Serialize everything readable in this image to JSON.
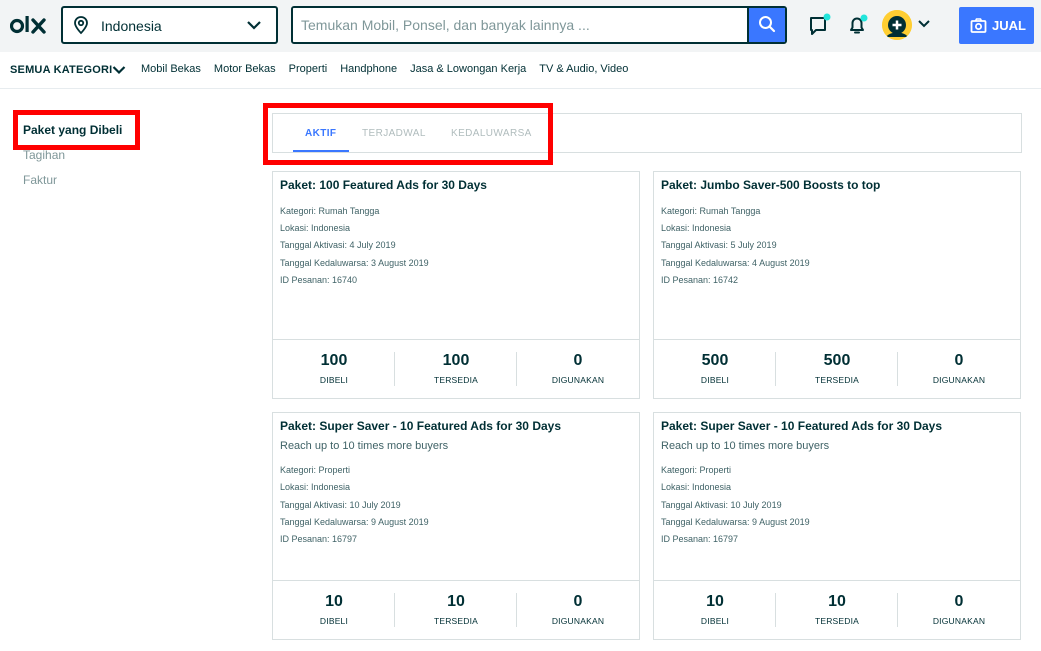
{
  "header": {
    "logo_text": "olx",
    "location": "Indonesia",
    "search_placeholder": "Temukan Mobil, Ponsel, dan banyak lainnya ...",
    "sell_label": "JUAL",
    "colors": {
      "accent": "#3a77ff",
      "dark": "#002f34",
      "avatar": "#ffce32",
      "notification_dot": "#23e5db"
    }
  },
  "categories": {
    "all_label": "SEMUA KATEGORI",
    "links": [
      "Mobil Bekas",
      "Motor Bekas",
      "Properti",
      "Handphone",
      "Jasa & Lowongan Kerja",
      "TV & Audio, Video"
    ]
  },
  "sidebar": {
    "items": [
      {
        "label": "Paket yang Dibeli",
        "active": true
      },
      {
        "label": "Tagihan",
        "active": false
      },
      {
        "label": "Faktur",
        "active": false
      }
    ]
  },
  "tabs": [
    {
      "label": "AKTIF",
      "active": true
    },
    {
      "label": "TERJADWAL",
      "active": false
    },
    {
      "label": "KEDALUWARSA",
      "active": false
    }
  ],
  "cards": [
    {
      "title": "Paket: 100 Featured Ads for 30 Days",
      "subtitle": "",
      "meta": [
        "Kategori: Rumah Tangga",
        "Lokasi: Indonesia",
        "Tanggal Aktivasi: 4 July 2019",
        "Tanggal Kedaluwarsa: 3 August 2019",
        "ID Pesanan: 16740"
      ],
      "stats": [
        {
          "value": "100",
          "label": "DIBELI"
        },
        {
          "value": "100",
          "label": "TERSEDIA"
        },
        {
          "value": "0",
          "label": "DIGUNAKAN"
        }
      ]
    },
    {
      "title": "Paket: Jumbo Saver-500 Boosts to top",
      "subtitle": "",
      "meta": [
        "Kategori: Rumah Tangga",
        "Lokasi: Indonesia",
        "Tanggal Aktivasi: 5 July 2019",
        "Tanggal Kedaluwarsa: 4 August 2019",
        "ID Pesanan: 16742"
      ],
      "stats": [
        {
          "value": "500",
          "label": "DIBELI"
        },
        {
          "value": "500",
          "label": "TERSEDIA"
        },
        {
          "value": "0",
          "label": "DIGUNAKAN"
        }
      ]
    },
    {
      "title": "Paket: Super Saver - 10 Featured Ads for 30 Days",
      "subtitle": "Reach up to 10 times more buyers",
      "meta": [
        "Kategori: Properti",
        "Lokasi: Indonesia",
        "Tanggal Aktivasi: 10 July 2019",
        "Tanggal Kedaluwarsa: 9 August 2019",
        "ID Pesanan: 16797"
      ],
      "stats": [
        {
          "value": "10",
          "label": "DIBELI"
        },
        {
          "value": "10",
          "label": "TERSEDIA"
        },
        {
          "value": "0",
          "label": "DIGUNAKAN"
        }
      ]
    },
    {
      "title": "Paket: Super Saver - 10 Featured Ads for 30 Days",
      "subtitle": "Reach up to 10 times more buyers",
      "meta": [
        "Kategori: Properti",
        "Lokasi: Indonesia",
        "Tanggal Aktivasi: 10 July 2019",
        "Tanggal Kedaluwarsa: 9 August 2019",
        "ID Pesanan: 16797"
      ],
      "stats": [
        {
          "value": "10",
          "label": "DIBELI"
        },
        {
          "value": "10",
          "label": "TERSEDIA"
        },
        {
          "value": "0",
          "label": "DIGUNAKAN"
        }
      ]
    }
  ]
}
